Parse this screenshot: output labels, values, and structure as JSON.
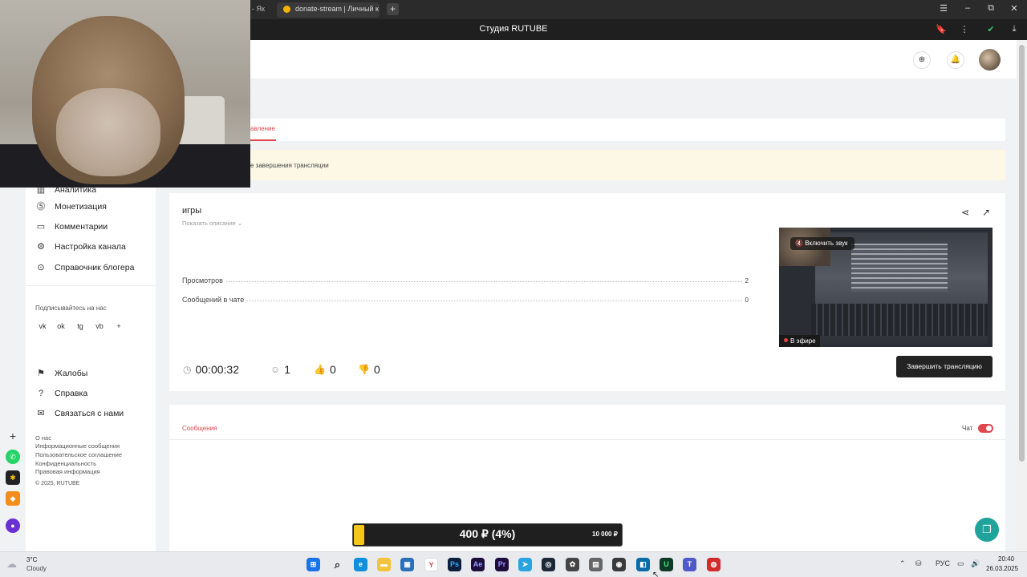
{
  "browser": {
    "left_tab_fragment": "- Як",
    "active_tab_title": "donate-stream | Личный к",
    "new_tab": "+",
    "page_title": "Студия RUTUBE",
    "win_controls": [
      "☰",
      "–",
      "⧉",
      "✕"
    ],
    "addr_icons": [
      "🔖",
      "⋮",
      "✔",
      "⤓"
    ]
  },
  "header": {
    "icons": [
      "upload-icon",
      "bell-icon"
    ]
  },
  "tabs": {
    "manage": "авление"
  },
  "warning": {
    "text": "е завершения трансляции"
  },
  "sidebar": {
    "items": [
      {
        "label": "Аналитика",
        "icon": "chart-icon"
      },
      {
        "label": "Монетизация",
        "icon": "coin-icon"
      },
      {
        "label": "Комментарии",
        "icon": "comment-icon"
      },
      {
        "label": "Настройка канала",
        "icon": "gear-icon"
      },
      {
        "label": "Справочник блогера",
        "icon": "book-icon"
      }
    ],
    "subscribe_label": "Подписывайтесь на нас",
    "socials": [
      "vk",
      "ok",
      "tg",
      "vb",
      "+"
    ],
    "support_items": [
      {
        "label": "Жалобы",
        "icon": "flag-icon"
      },
      {
        "label": "Справка",
        "icon": "help-icon"
      },
      {
        "label": "Связаться с нами",
        "icon": "mail-icon"
      }
    ],
    "footer": [
      "О нас",
      "Информационные сообщения",
      "Пользовательское соглашение",
      "Конфиденциальность",
      "Правовая информация",
      "© 2025, RUTUBE"
    ]
  },
  "stream": {
    "title": "игры",
    "show_description": "Показать описание ⌄",
    "stats": [
      {
        "label": "Просмотров",
        "value": "2"
      },
      {
        "label": "Сообщений в чате",
        "value": "0"
      }
    ],
    "duration": "00:00:32",
    "viewers": "1",
    "likes": "0",
    "dislikes": "0",
    "unmute_label": "Включить звук",
    "live_label": "В эфире",
    "end_button": "Завершить трансляцию"
  },
  "messages": {
    "tab_label": "Сообщения",
    "chat_label": "Чат",
    "chat_enabled": true
  },
  "donation": {
    "amount_text": "400 ₽ (4%)",
    "goal_text": "10 000 ₽",
    "progress_fraction": 0.04
  },
  "taskbar": {
    "weather_temp": "3°C",
    "weather_desc": "Cloudy",
    "time": "20:40",
    "date": "26.03.2025",
    "lang": "РУС"
  },
  "colors": {
    "accent_red": "#e0464b",
    "donate_yellow": "#f5c518",
    "fab_teal": "#1fa39a"
  }
}
